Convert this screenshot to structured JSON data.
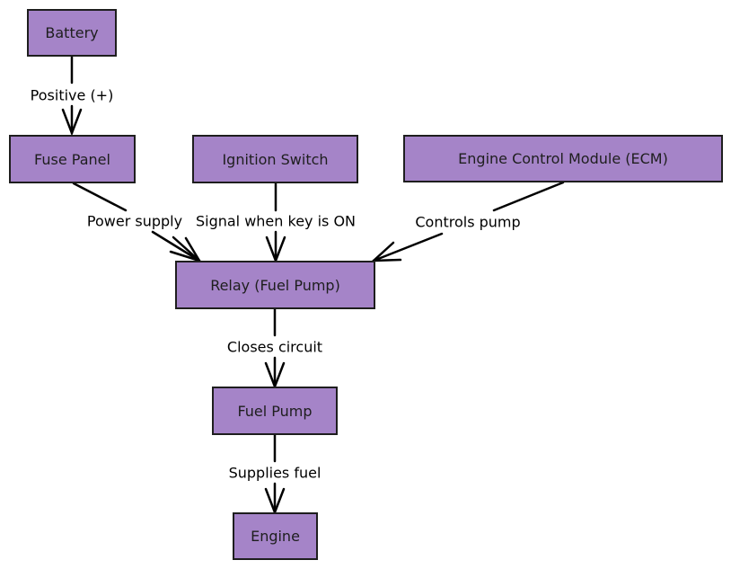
{
  "diagram": {
    "nodes": {
      "battery": "Battery",
      "fuse_panel": "Fuse Panel",
      "ignition_switch": "Ignition Switch",
      "ecm": "Engine Control Module (ECM)",
      "relay": "Relay (Fuel Pump)",
      "fuel_pump": "Fuel Pump",
      "engine": "Engine"
    },
    "edges": {
      "battery_to_fuse": "Positive (+)",
      "fuse_to_relay": "Power supply",
      "ignition_to_relay": "Signal when key is ON",
      "ecm_to_relay": "Controls pump",
      "relay_to_pump": "Closes circuit",
      "pump_to_engine": "Supplies fuel"
    },
    "colors": {
      "node_fill": "#a584c8",
      "node_border": "#1e1e1e",
      "edge": "#000000"
    }
  }
}
